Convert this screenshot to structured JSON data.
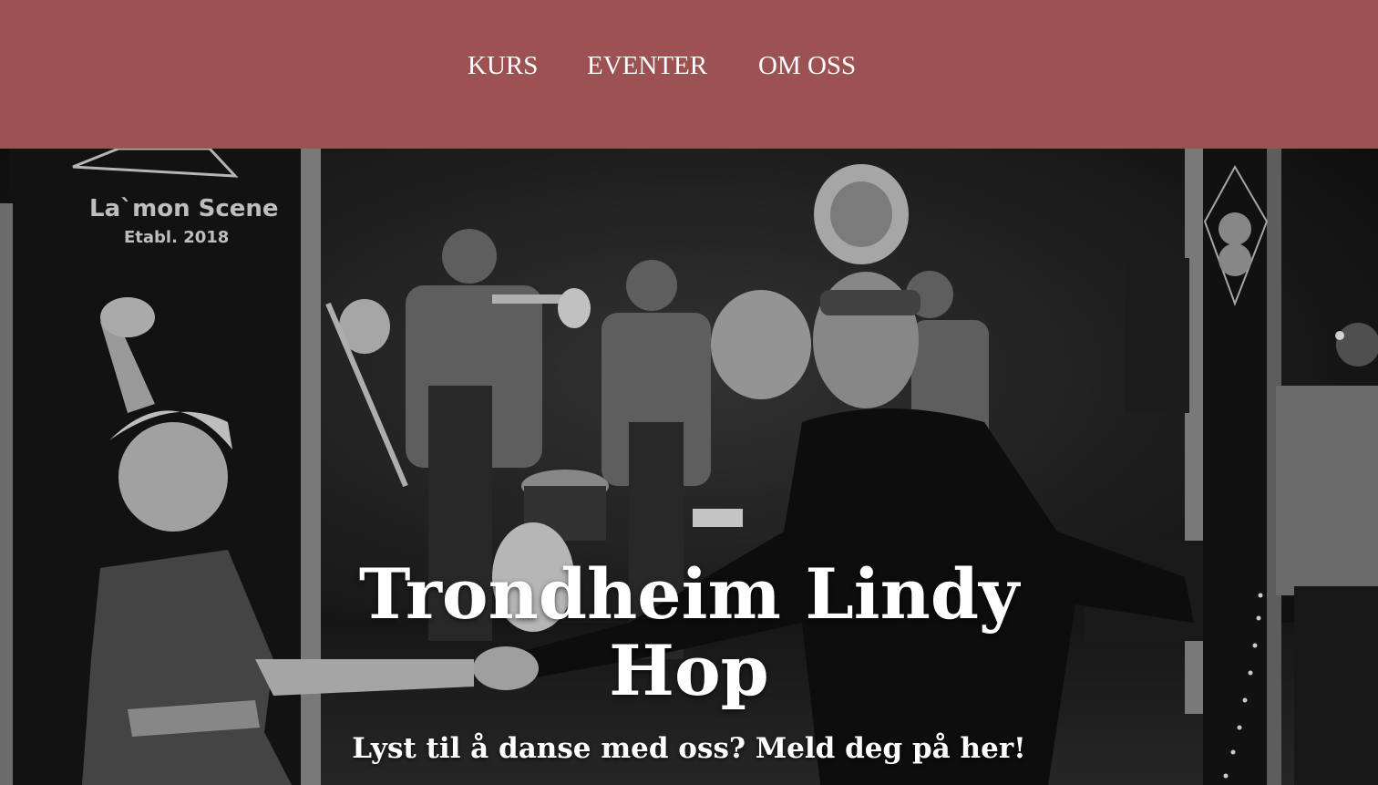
{
  "nav": {
    "items": [
      {
        "label": "KURS"
      },
      {
        "label": "EVENTER"
      },
      {
        "label": "OM OSS"
      }
    ]
  },
  "hero": {
    "title": "Trondheim Lindy Hop",
    "subtitle": "Lyst til å danse med oss? Meld deg på her!",
    "photo_sign_line1": "La`mon Scene",
    "photo_sign_line2": "Etabl. 2018"
  },
  "colors": {
    "header_bg": "#9c5152",
    "nav_text": "#ffffff",
    "hero_text": "#ffffff"
  }
}
